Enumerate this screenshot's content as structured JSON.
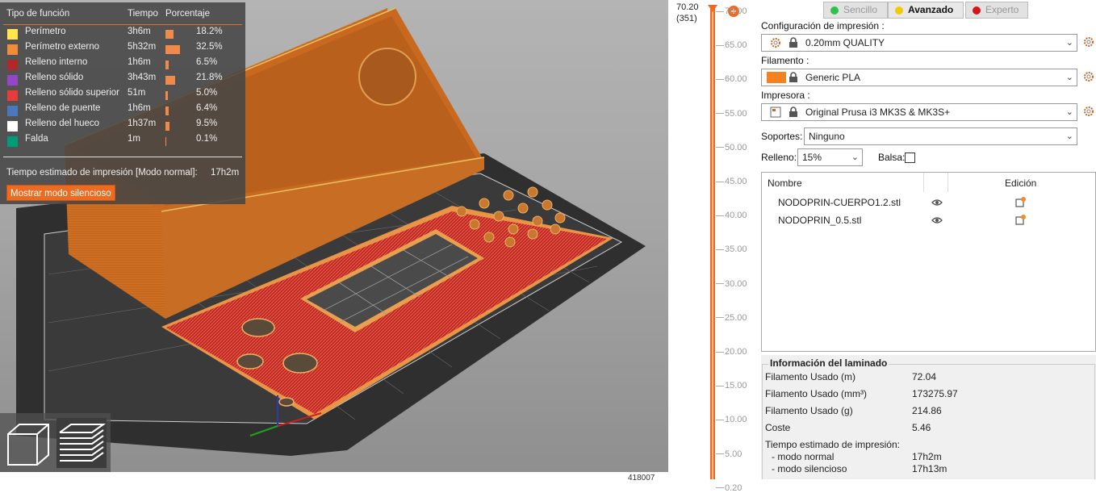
{
  "legend": {
    "headers": {
      "type": "Tipo de función",
      "time": "Tiempo",
      "percent": "Porcentaje"
    },
    "rows": [
      {
        "label": "Perímetro",
        "time": "3h6m",
        "percent": "18.2%",
        "fraction": 0.182,
        "color": "#ffe64d"
      },
      {
        "label": "Perímetro externo",
        "time": "5h32m",
        "percent": "32.5%",
        "fraction": 0.325,
        "color": "#f28c3b"
      },
      {
        "label": "Relleno interno",
        "time": "1h6m",
        "percent": "6.5%",
        "fraction": 0.065,
        "color": "#b22828"
      },
      {
        "label": "Relleno sólido",
        "time": "3h43m",
        "percent": "21.8%",
        "fraction": 0.218,
        "color": "#9645c8"
      },
      {
        "label": "Relleno sólido superior",
        "time": "51m",
        "percent": "5.0%",
        "fraction": 0.05,
        "color": "#e63c3c"
      },
      {
        "label": "Relleno de puente",
        "time": "1h6m",
        "percent": "6.4%",
        "fraction": 0.064,
        "color": "#4a78c0"
      },
      {
        "label": "Relleno del hueco",
        "time": "1h37m",
        "percent": "9.5%",
        "fraction": 0.095,
        "color": "#ffffff"
      },
      {
        "label": "Falda",
        "time": "1m",
        "percent": "0.1%",
        "fraction": 0.001,
        "color": "#009c76"
      }
    ],
    "estimate_label": "Tiempo estimado de impresión [Modo normal]:",
    "estimate_value": "17h2m",
    "silent_button": "Mostrar modo silencioso"
  },
  "viewport": {
    "coord_label": "418007"
  },
  "slider": {
    "top_value": "70.20",
    "top_layer": "(351)",
    "ticks": [
      "70.00",
      "65.00",
      "60.00",
      "55.00",
      "50.00",
      "45.00",
      "40.00",
      "35.00",
      "30.00",
      "25.00",
      "20.00",
      "15.00",
      "10.00",
      "5.00",
      "0.20"
    ]
  },
  "modes": {
    "simple": "Sencillo",
    "advanced": "Avanzado",
    "expert": "Experto"
  },
  "config": {
    "print_label": "Configuración de impresión :",
    "print_value": "0.20mm QUALITY",
    "filament_label": "Filamento :",
    "filament_value": "Generic PLA",
    "filament_color": "#f58220",
    "printer_label": "Impresora :",
    "printer_value": "Original Prusa i3 MK3S & MK3S+",
    "supports_label": "Soportes:",
    "supports_value": "Ninguno",
    "infill_label": "Relleno:",
    "infill_value": "15%",
    "brim_label": "Balsa:"
  },
  "objects": {
    "col_name": "Nombre",
    "col_edit": "Edición",
    "items": [
      {
        "name": "NODOPRIN-CUERPO1.2.stl"
      },
      {
        "name": "NODOPRIN_0.5.stl"
      }
    ]
  },
  "slice_info": {
    "title": "Información del laminado",
    "rows": [
      {
        "label": "Filamento Usado (m)",
        "value": "72.04"
      },
      {
        "label": "Filamento Usado (mm³)",
        "value": "173275.97"
      },
      {
        "label": "Filamento Usado (g)",
        "value": "214.86"
      },
      {
        "label": "Coste",
        "value": "5.46"
      }
    ],
    "time_label": "Tiempo estimado de impresión:",
    "normal_label": "- modo normal",
    "normal_value": "17h2m",
    "silent_label": "- modo silencioso",
    "silent_value": "17h13m"
  }
}
